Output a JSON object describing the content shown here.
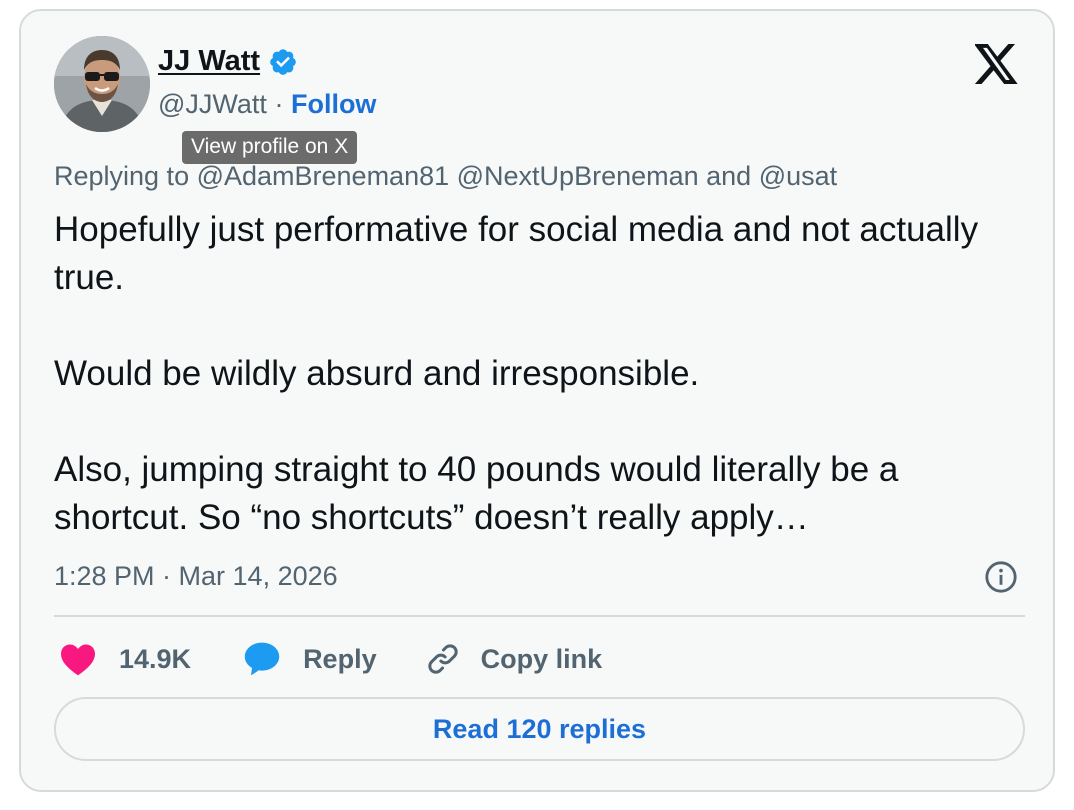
{
  "author": {
    "name": "JJ Watt",
    "handle": "@JJWatt",
    "separator": "·",
    "follow_label": "Follow",
    "verified": true,
    "verified_color": "#1d9bf0"
  },
  "tooltip": "View profile on X",
  "replying_to": "Replying to @AdamBreneman81 @NextUpBreneman and @usat",
  "tweet": {
    "paragraphs": [
      "Hopefully just performative for social media and not actually true.",
      "Would be wildly absurd and irresponsible.",
      "Also, jumping straight to 40 pounds would literally be a shortcut. So “no shortcuts” doesn’t really apply…"
    ]
  },
  "timestamp": "1:28 PM · Mar 14, 2026",
  "actions": {
    "like_count": "14.9K",
    "reply_label": "Reply",
    "copy_label": "Copy link"
  },
  "read_replies_label": "Read 120 replies",
  "colors": {
    "accent": "#1d6fd6",
    "like": "#f91880",
    "reply_icon": "#1d9bf0",
    "muted_text": "#536471",
    "card_background": "#f7f9f9"
  },
  "icons": {
    "logo": "x-logo-icon",
    "info": "info-icon",
    "like": "heart-icon",
    "reply": "speech-bubble-icon",
    "copy": "link-icon"
  }
}
